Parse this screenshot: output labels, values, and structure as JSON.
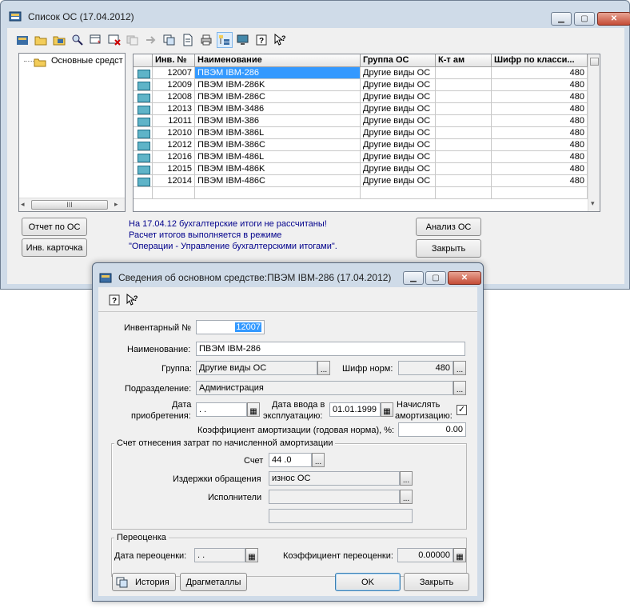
{
  "main": {
    "title": "Список ОС (17.04.2012)",
    "tree_root": "Основные средст",
    "columns": [
      "Инв. №",
      "Наименование",
      "Группа ОС",
      "К-т ам",
      "Шифр по класси..."
    ],
    "rows": [
      {
        "inv": "12007",
        "name": "ПВЭМ IBM-286",
        "group": "Другие виды ОС",
        "kt": "",
        "code": "480"
      },
      {
        "inv": "12009",
        "name": "ПВЭМ IBM-286K",
        "group": "Другие виды ОС",
        "kt": "",
        "code": "480"
      },
      {
        "inv": "12008",
        "name": "ПВЭМ IBM-286C",
        "group": "Другие виды ОС",
        "kt": "",
        "code": "480"
      },
      {
        "inv": "12013",
        "name": "ПВЭМ IBM-3486",
        "group": "Другие виды ОС",
        "kt": "",
        "code": "480"
      },
      {
        "inv": "12011",
        "name": "ПВЭМ IBM-386",
        "group": "Другие виды ОС",
        "kt": "",
        "code": "480"
      },
      {
        "inv": "12010",
        "name": "ПВЭМ IBM-386L",
        "group": "Другие виды ОС",
        "kt": "",
        "code": "480"
      },
      {
        "inv": "12012",
        "name": "ПВЭМ IBM-386C",
        "group": "Другие виды ОС",
        "kt": "",
        "code": "480"
      },
      {
        "inv": "12016",
        "name": "ПВЭМ IBM-486L",
        "group": "Другие виды ОС",
        "kt": "",
        "code": "480"
      },
      {
        "inv": "12015",
        "name": "ПВЭМ IBM-486K",
        "group": "Другие виды ОС",
        "kt": "",
        "code": "480"
      },
      {
        "inv": "12014",
        "name": "ПВЭМ IBM-486C",
        "group": "Другие виды ОС",
        "kt": "",
        "code": "480"
      }
    ],
    "info_lines": [
      "На 17.04.12 бухгалтерские итоги не рассчитаны!",
      "Расчет итогов выполняется в режиме",
      "\"Операции - Управление бухгалтерскими итогами\"."
    ],
    "btn_report": "Отчет по ОС",
    "btn_card": "Инв. карточка",
    "btn_analysis": "Анализ ОС",
    "btn_close": "Закрыть",
    "hscroll_grip": "III"
  },
  "dialog": {
    "title": "Сведения об основном средстве:ПВЭМ IBM-286 (17.04.2012)",
    "inv_label": "Инвентарный №",
    "inv_value": "12007",
    "name_label": "Наименование:",
    "name_value": "ПВЭМ IBM-286",
    "group_label": "Группа:",
    "group_value": "Другие виды ОС",
    "code_label": "Шифр норм:",
    "code_value": "480",
    "dept_label": "Подразделение:",
    "dept_value": "Администрация",
    "acq_label_1": "Дата",
    "acq_label_2": "приобретения:",
    "acq_value": " .  .",
    "commission_label_1": "Дата ввода в",
    "commission_label_2": "эксплуатацию:",
    "commission_value": "01.01.1999",
    "amort_label_1": "Начислять",
    "amort_label_2": "амортизацию:",
    "amort_checked": true,
    "coef_label": "Коэффициент амортизации (годовая норма), %:",
    "coef_value": "0.00",
    "account_group": "Счет отнесения затрат по начисленной амортизации",
    "account_label": "Счет",
    "account_value": "44 .0",
    "costs_label": "Издержки обращения",
    "costs_value": "износ ОС",
    "executors_label": "Исполнители",
    "executors_value": "",
    "reval_group": "Переоценка",
    "reval_date_label": "Дата переоценки:",
    "reval_date_value": " .  .",
    "reval_coef_label": "Коэффициент переоценки:",
    "reval_coef_value": "0.00000",
    "btn_history": "История",
    "btn_metals": "Драгметаллы",
    "btn_ok": "OK",
    "btn_close": "Закрыть"
  },
  "colors": {
    "frame": "#cfdbe8",
    "selection": "#3399ff",
    "info_text": "#00008b",
    "close_button": "#c44c36"
  }
}
